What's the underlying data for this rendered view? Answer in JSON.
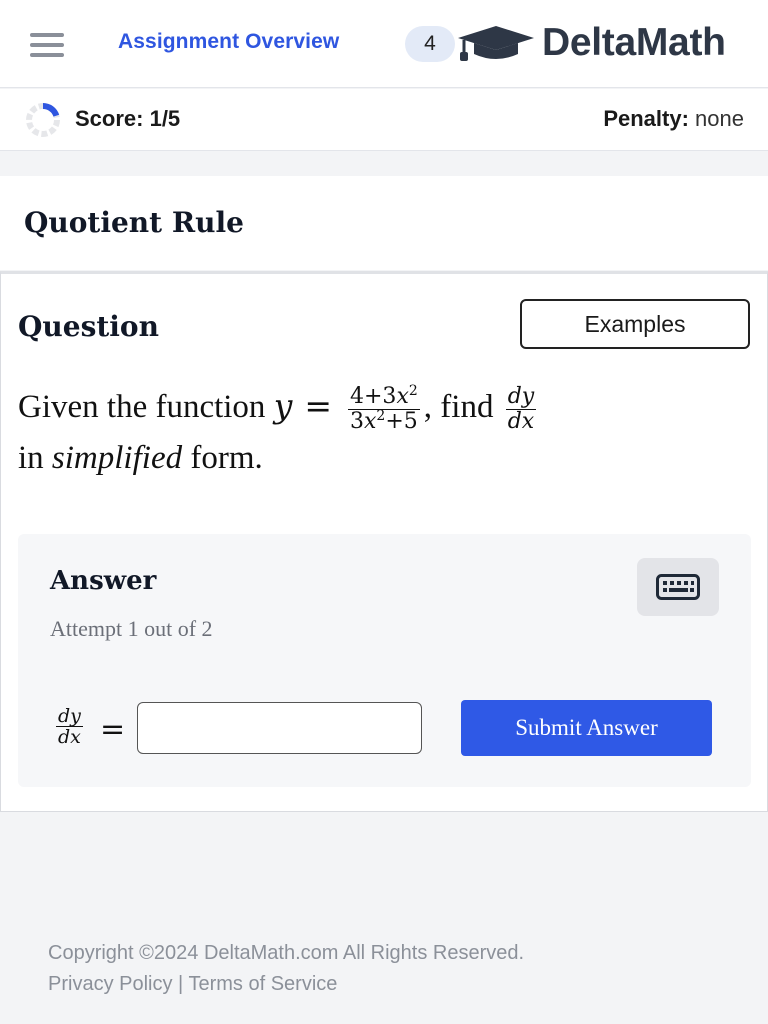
{
  "header": {
    "assignment_link": "Assignment Overview",
    "badge_count": "4",
    "logo_text": "DeltaMath"
  },
  "score": {
    "label": "Score: 1/5",
    "penalty_label": "Penalty:",
    "penalty_value": "none",
    "progress_fraction": 0.2
  },
  "problem": {
    "title": "Quotient Rule"
  },
  "question": {
    "heading": "Question",
    "examples_label": "Examples",
    "prefix": "Given the function",
    "var_y": "y",
    "equals": "=",
    "num_a": "4+3",
    "num_x": "x",
    "num_exp": "2",
    "den_a": "3",
    "den_x": "x",
    "den_exp": "2",
    "den_b": "+5",
    "comma_find": ", find",
    "d_num": "dy",
    "d_den": "dx",
    "line2_pre": "in",
    "line2_emph": "simplified",
    "line2_post": "form."
  },
  "answer": {
    "heading": "Answer",
    "attempt": "Attempt 1 out of 2",
    "lhs_num": "dy",
    "lhs_den": "dx",
    "equals": "=",
    "input_value": "",
    "submit_label": "Submit Answer"
  },
  "footer": {
    "copyright": "Copyright ©2024 DeltaMath.com All Rights Reserved.",
    "privacy": "Privacy Policy",
    "separator": "|",
    "terms": "Terms of Service"
  },
  "colors": {
    "accent": "#2f59e6",
    "link": "#2f56e0",
    "badge_bg": "#e3eaf7",
    "logo_text": "#2e3746"
  },
  "icons": [
    "hamburger-icon",
    "graduation-cap-icon",
    "progress-ring-icon",
    "keyboard-icon"
  ]
}
